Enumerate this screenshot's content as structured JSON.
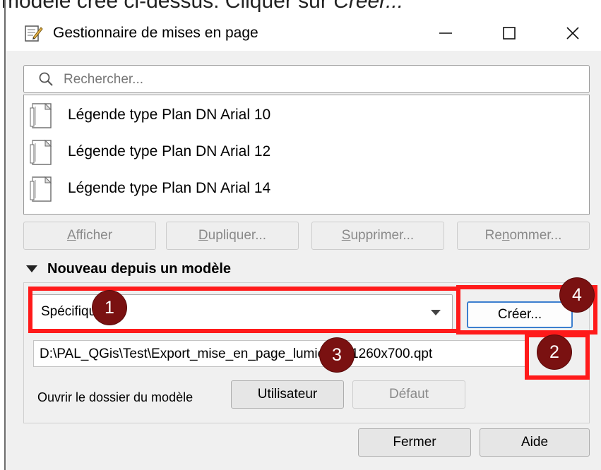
{
  "caption": {
    "text_plain": "modèle créé ci-dessus. Cliquer sur ",
    "text_italic": "Créer..."
  },
  "window": {
    "title": "Gestionnaire de mises en page",
    "minimize_label": "—",
    "maximize_label": "☐",
    "close_label": "✕"
  },
  "search": {
    "placeholder": "Rechercher..."
  },
  "layouts": [
    {
      "label": "Légende type Plan DN Arial 10"
    },
    {
      "label": "Légende type Plan DN Arial 12"
    },
    {
      "label": "Légende type Plan DN Arial 14"
    }
  ],
  "actions": {
    "show": {
      "first": "A",
      "rest": "fficher"
    },
    "duplicate": {
      "first": "D",
      "rest": "upliquer..."
    },
    "delete": {
      "first": "S",
      "rest": "upprimer..."
    },
    "rename": {
      "first": "Re",
      "mid": "n",
      "rest": "ommer..."
    }
  },
  "template_section": {
    "title": "Nouveau depuis un modèle",
    "combo_value": "Spécifique",
    "create_label": "Créer...",
    "path_value": "D:\\PAL_QGis\\Test\\Export_mise_en_page_lumieres_1260x700.qpt",
    "folder_label": "Ouvrir le dossier du modèle",
    "user_button": "Utilisateur",
    "default_button": "Défaut"
  },
  "footer": {
    "close_button": "Fermer",
    "help_button": "Aide"
  },
  "markers": [
    "1",
    "2",
    "3",
    "4"
  ],
  "colors": {
    "highlight": "#ff1a1a",
    "marker_fill": "#7a1111",
    "create_button_border": "#3c7fcf"
  }
}
